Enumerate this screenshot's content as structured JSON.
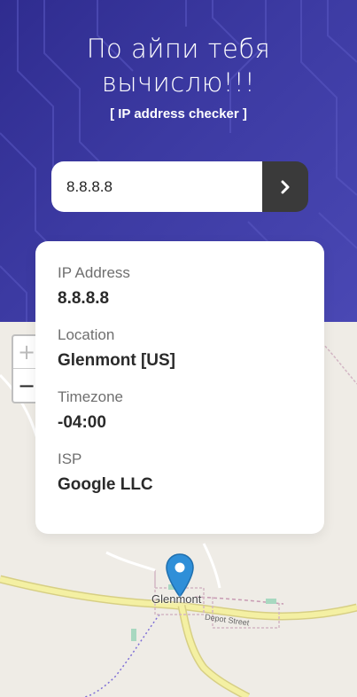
{
  "header": {
    "title_line1": "По айпи тебя",
    "title_line2": "вычислю!!!",
    "subtitle": "[ IP address checker ]"
  },
  "search": {
    "value": "8.8.8.8",
    "submit_icon": "chevron-right-icon"
  },
  "info": {
    "ip_label": "IP Address",
    "ip_value": "8.8.8.8",
    "location_label": "Location",
    "location_value": "Glenmont [US]",
    "timezone_label": "Timezone",
    "timezone_value": "-04:00",
    "isp_label": "ISP",
    "isp_value": "Google LLC"
  },
  "map": {
    "zoom_in": "+",
    "zoom_out": "−",
    "place_label": "Glenmont",
    "street_label": "Depot Street",
    "marker_icon": "map-pin-icon"
  },
  "colors": {
    "header_bg": "#3c3aa2",
    "button_bg": "#3a3a3a",
    "marker": "#2f8fd8",
    "road": "#f4f0a3"
  }
}
